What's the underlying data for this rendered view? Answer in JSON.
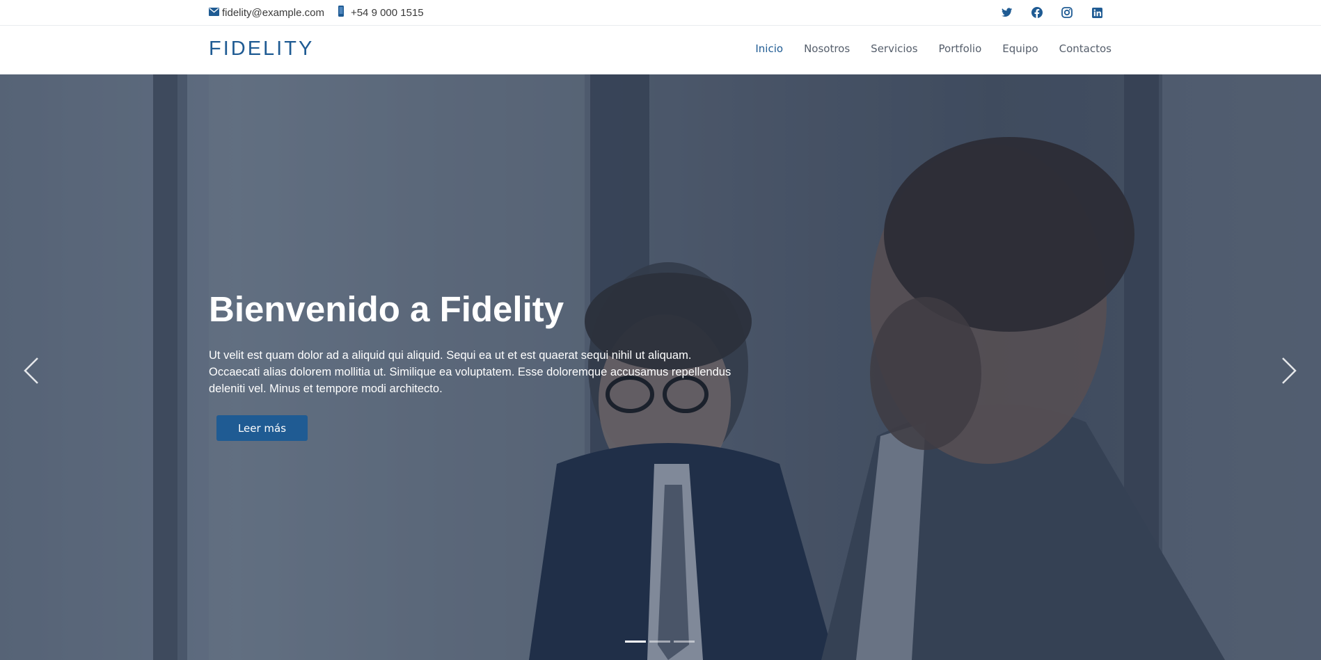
{
  "topbar": {
    "email": "fidelity@example.com",
    "phone": "+54 9 000 1515",
    "social_icons": [
      "twitter-icon",
      "facebook-icon",
      "instagram-icon",
      "linkedin-icon"
    ]
  },
  "header": {
    "logo": "FIDELITY",
    "nav": [
      "Inicio",
      "Nosotros",
      "Servicios",
      "Portfolio",
      "Equipo",
      "Contactos"
    ],
    "active_nav": "Inicio"
  },
  "hero": {
    "title": "Bienvenido a Fidelity",
    "text": "Ut velit est quam dolor ad a aliquid qui aliquid. Sequi ea ut et est quaerat sequi nihil ut aliquam. Occaecati alias dolorem mollitia ut. Similique ea voluptatem. Esse doloremque accusamus repellendus deleniti vel. Minus et tempore modi architecto.",
    "button": "Leer más",
    "slides_count": 3,
    "active_slide": 1
  },
  "colors": {
    "brand": "#1f5b93",
    "nav_text": "#555e6b",
    "white": "#ffffff"
  }
}
